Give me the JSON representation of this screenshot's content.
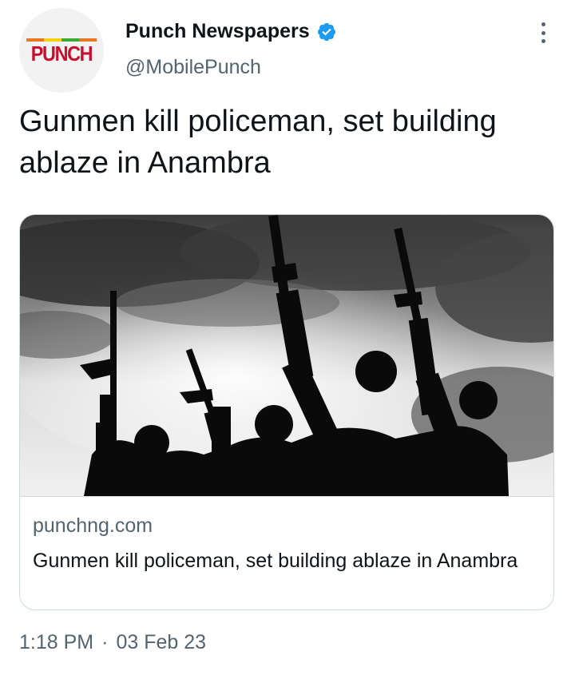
{
  "author": {
    "name": "Punch Newspapers",
    "handle": "@MobilePunch",
    "logo_text": "PUNCH",
    "verified_icon": "verified-badge-icon",
    "verified_color": "#1d9bf0"
  },
  "menu": {
    "icon": "more-vertical-icon"
  },
  "tweet": {
    "text": "Gunmen kill policeman, set building ablaze in Anambra"
  },
  "card": {
    "image_icon": "article-thumbnail-image",
    "domain": "punchng.com",
    "title": "Gunmen kill policeman, set building ablaze in Anambra"
  },
  "meta": {
    "time": "1:18 PM",
    "separator": "·",
    "date": "03 Feb 23"
  },
  "colors": {
    "text": "#0f1419",
    "secondary": "#536471",
    "border": "#cfd9de",
    "brand_red": "#c8102e"
  }
}
